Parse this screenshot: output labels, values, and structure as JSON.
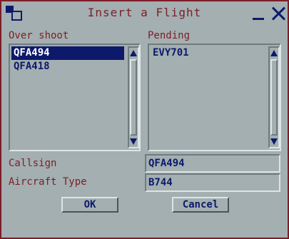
{
  "window": {
    "title": "Insert a Flight"
  },
  "overshoot": {
    "label": "Over shoot",
    "items": [
      {
        "text": "QFA494",
        "selected": true
      },
      {
        "text": "QFA418",
        "selected": false
      }
    ]
  },
  "pending": {
    "label": "Pending",
    "items": [
      {
        "text": "EVY701",
        "selected": false
      }
    ]
  },
  "callsign": {
    "label": "Callsign",
    "value": "QFA494"
  },
  "aircraft_type": {
    "label": "Aircraft Type",
    "value": "B744"
  },
  "buttons": {
    "ok": "OK",
    "cancel": "Cancel"
  },
  "icons": {
    "app": "app-icon",
    "minimize": "minimize-icon",
    "close": "close-icon"
  },
  "colors": {
    "text": "#7e1d28",
    "value": "#0d1a6b",
    "background": "#a3afb0",
    "selection": "#0d1a6b"
  }
}
